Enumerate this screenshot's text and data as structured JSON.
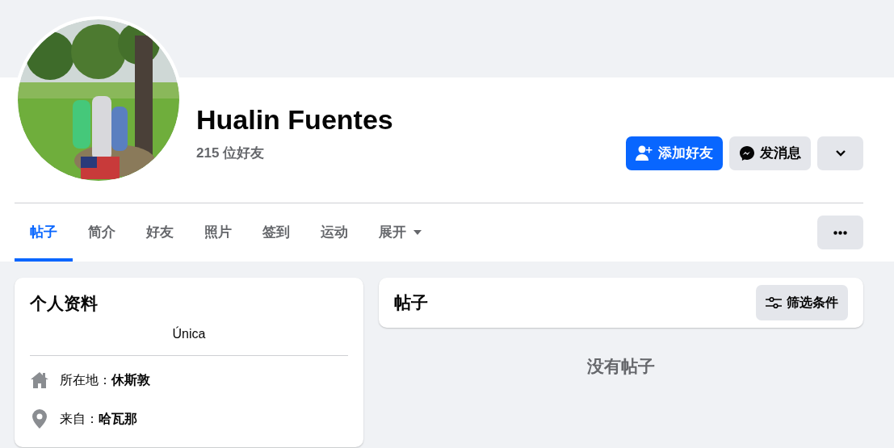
{
  "profile": {
    "name": "Hualin Fuentes",
    "friends_count": "215 位好友"
  },
  "actions": [
    {
      "label": "添加好友",
      "kind": "primary"
    },
    {
      "label": "发消息",
      "kind": "message"
    },
    {
      "kind": "dropdown"
    }
  ],
  "tabs": [
    {
      "label": "帖子",
      "selected": true,
      "has_menu": false
    },
    {
      "label": "简介",
      "selected": false,
      "has_menu": false
    },
    {
      "label": "好友",
      "selected": false,
      "has_menu": false
    },
    {
      "label": "照片",
      "selected": false,
      "has_menu": false
    },
    {
      "label": "签到",
      "selected": false,
      "has_menu": false
    },
    {
      "label": "运动",
      "selected": false,
      "has_menu": false
    },
    {
      "label": "展开",
      "selected": false,
      "has_menu": true
    }
  ],
  "intro": {
    "title": "个人资料",
    "bio": "Única",
    "items": [
      {
        "kind": "home",
        "text": "所在地：**休斯敦**"
      },
      {
        "kind": "pin",
        "text": "来自：**哈瓦那**"
      }
    ]
  },
  "posts": {
    "title": "帖子",
    "filter_button": "筛选条件",
    "empty_text": "没有帖子"
  }
}
